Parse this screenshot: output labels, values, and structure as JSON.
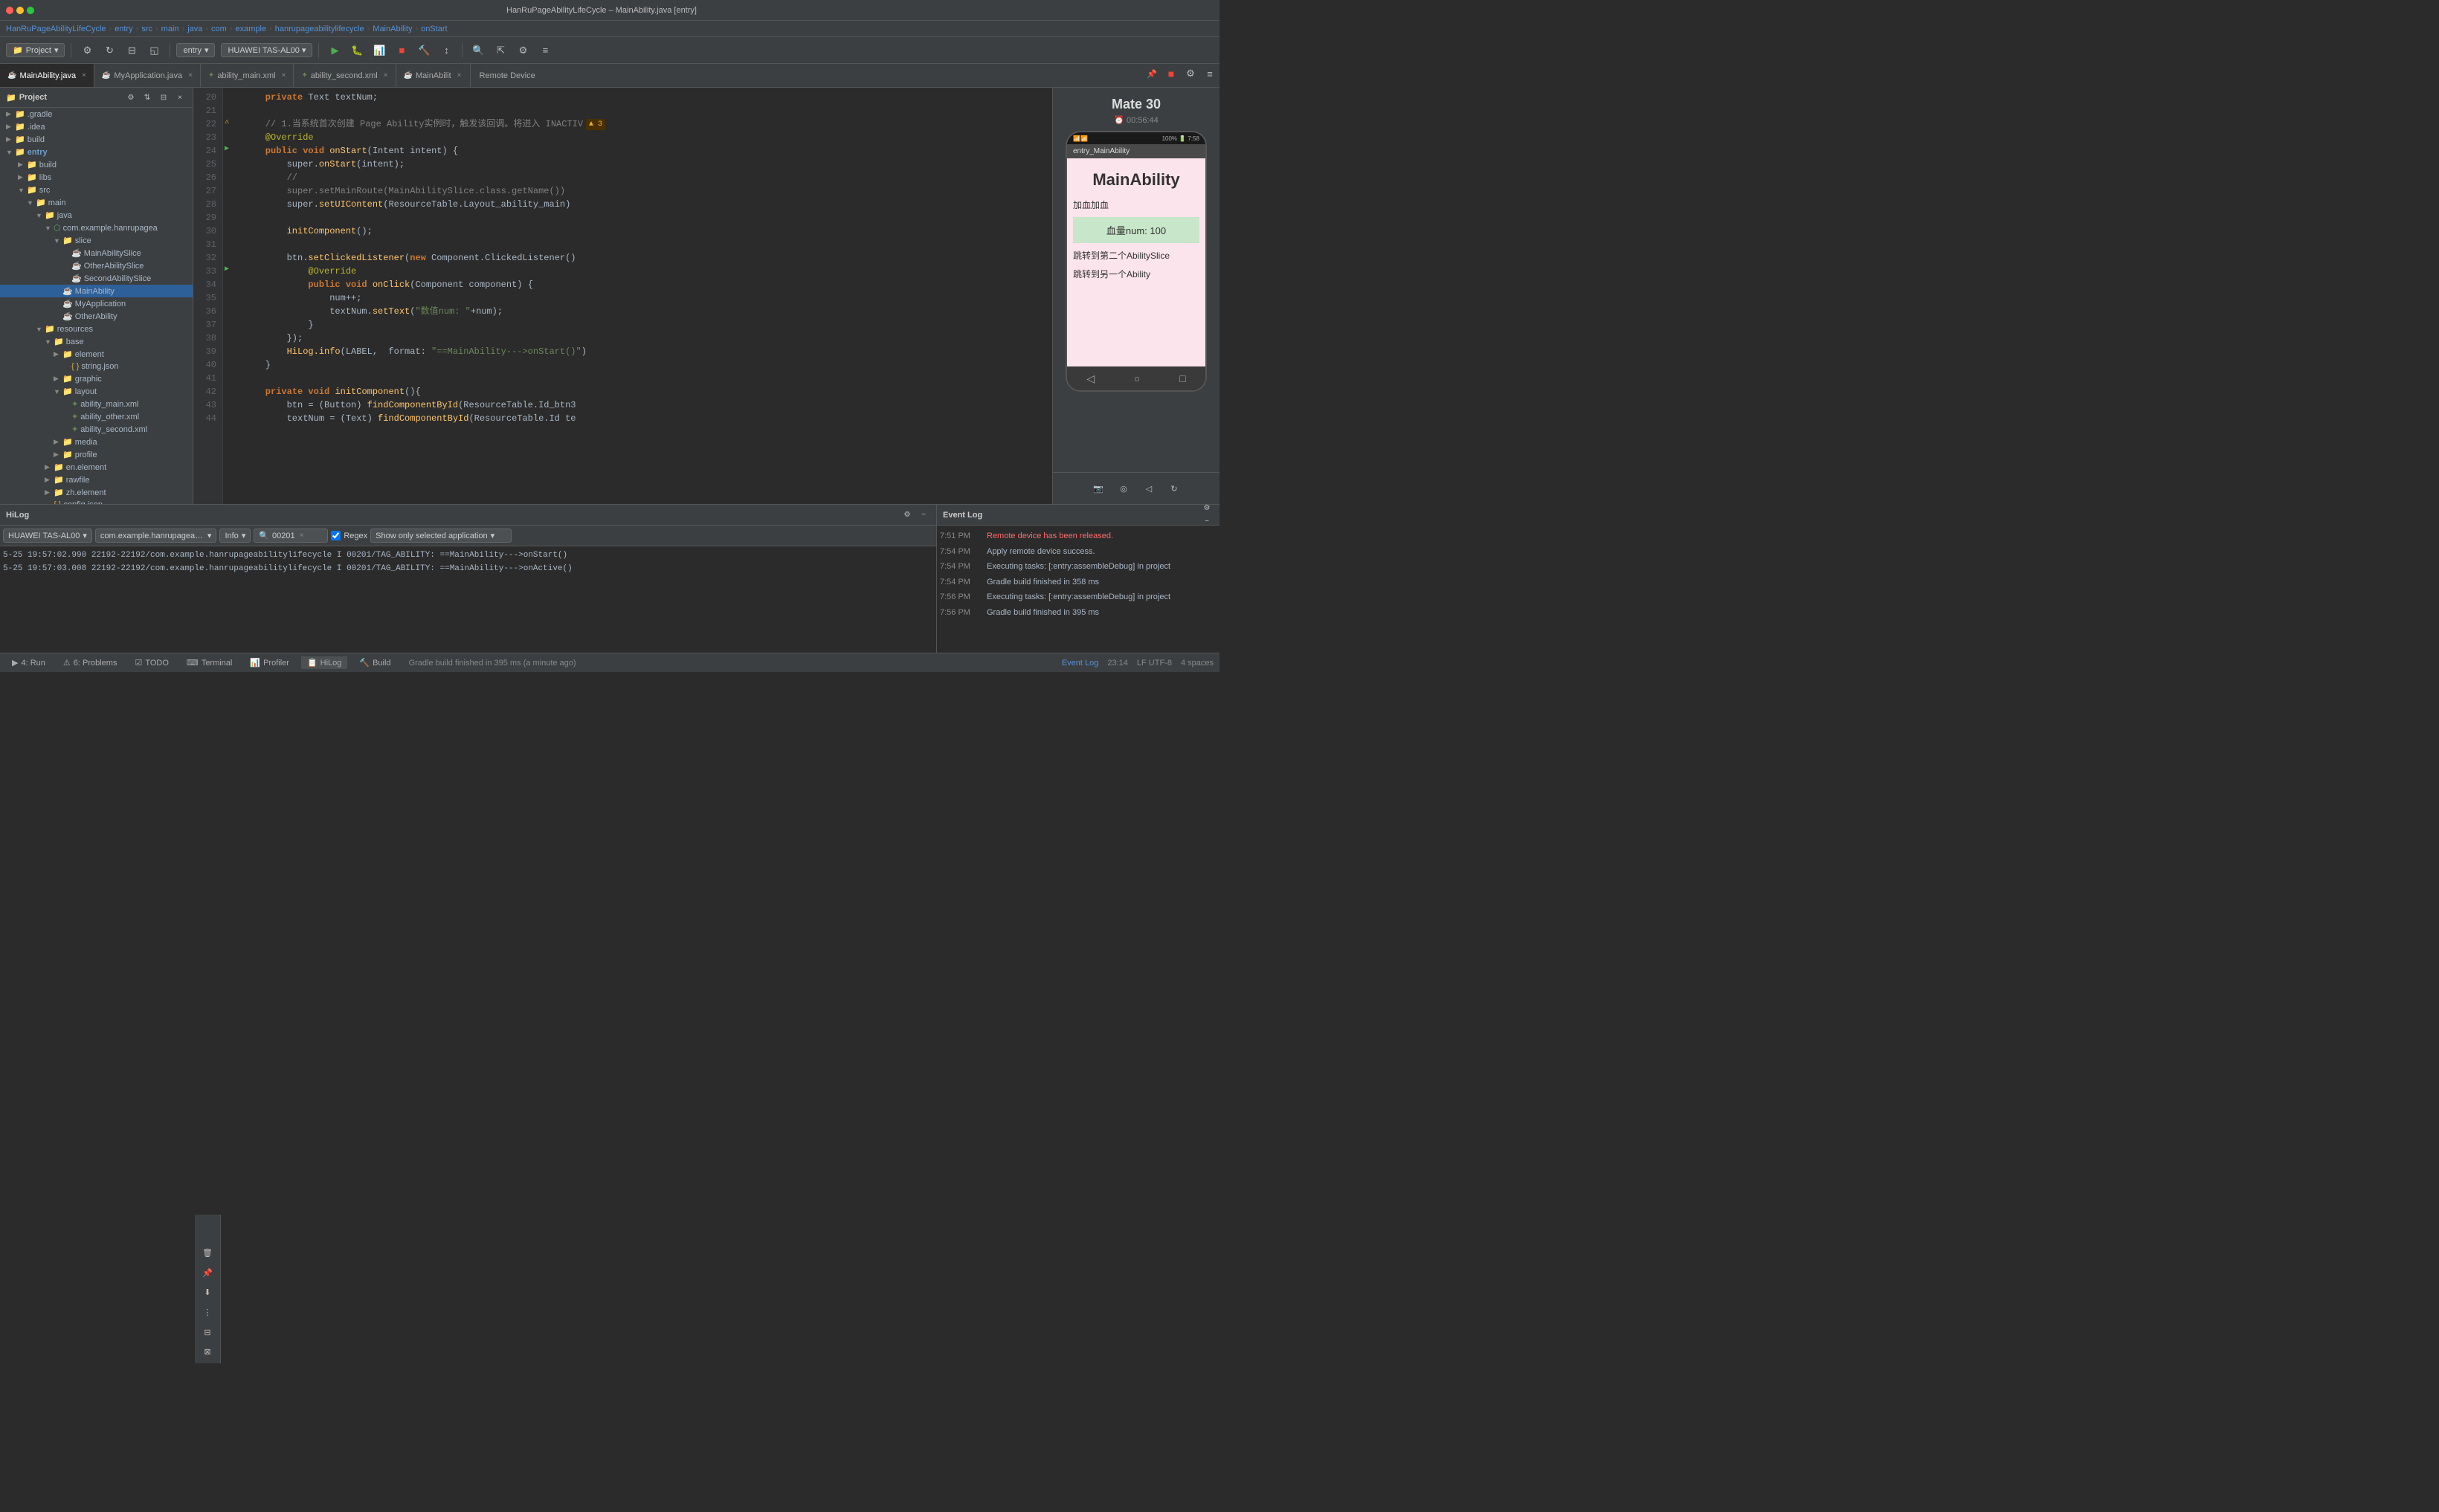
{
  "titlebar": {
    "title": "HanRuPageAbilityLifeCycle – MainAbility.java [entry]",
    "traffic_lights": [
      "red",
      "yellow",
      "green"
    ]
  },
  "breadcrumb": {
    "items": [
      "HanRuPageAbilityLifeCycle",
      "entry",
      "src",
      "main",
      "java",
      "com",
      "example",
      "hanrupageabilitylifecycle",
      "MainAbility",
      "onStart"
    ]
  },
  "toolbar": {
    "project_label": "Project",
    "entry_label": "entry",
    "device_label": "HUAWEI TAS-AL00"
  },
  "tabs": [
    {
      "label": "MainAbility.java",
      "type": "java",
      "active": true
    },
    {
      "label": "MyApplication.java",
      "type": "java",
      "active": false
    },
    {
      "label": "ability_main.xml",
      "type": "xml",
      "active": false
    },
    {
      "label": "ability_second.xml",
      "type": "xml",
      "active": false
    },
    {
      "label": "MainAbilit",
      "type": "java",
      "active": false
    },
    {
      "label": "Remote Device",
      "type": "remote",
      "active": false
    }
  ],
  "sidebar": {
    "project_label": "Project",
    "tree": [
      {
        "label": ".gradle",
        "level": 1,
        "type": "folder",
        "expanded": false
      },
      {
        "label": ".idea",
        "level": 1,
        "type": "folder",
        "expanded": false
      },
      {
        "label": "build",
        "level": 1,
        "type": "folder",
        "expanded": false
      },
      {
        "label": "entry",
        "level": 1,
        "type": "folder",
        "expanded": true,
        "active": true
      },
      {
        "label": "build",
        "level": 2,
        "type": "folder",
        "expanded": false
      },
      {
        "label": "libs",
        "level": 2,
        "type": "folder",
        "expanded": false
      },
      {
        "label": "src",
        "level": 2,
        "type": "folder",
        "expanded": true
      },
      {
        "label": "main",
        "level": 3,
        "type": "folder",
        "expanded": true
      },
      {
        "label": "java",
        "level": 4,
        "type": "folder",
        "expanded": true
      },
      {
        "label": "com.example.hanrupagea",
        "level": 5,
        "type": "package",
        "expanded": true
      },
      {
        "label": "slice",
        "level": 6,
        "type": "folder",
        "expanded": true
      },
      {
        "label": "MainAbilitySlice",
        "level": 7,
        "type": "java"
      },
      {
        "label": "OtherAbilitySlice",
        "level": 7,
        "type": "java"
      },
      {
        "label": "SecondAbilitySlice",
        "level": 7,
        "type": "java"
      },
      {
        "label": "MainAbility",
        "level": 6,
        "type": "java",
        "selected": true
      },
      {
        "label": "MyApplication",
        "level": 6,
        "type": "java"
      },
      {
        "label": "OtherAbility",
        "level": 6,
        "type": "java"
      },
      {
        "label": "resources",
        "level": 4,
        "type": "folder",
        "expanded": true
      },
      {
        "label": "base",
        "level": 5,
        "type": "folder",
        "expanded": true
      },
      {
        "label": "element",
        "level": 6,
        "type": "folder",
        "expanded": false
      },
      {
        "label": "string.json",
        "level": 7,
        "type": "json"
      },
      {
        "label": "graphic",
        "level": 6,
        "type": "folder",
        "expanded": false
      },
      {
        "label": "layout",
        "level": 6,
        "type": "folder",
        "expanded": false
      },
      {
        "label": "ability_main.xml",
        "level": 7,
        "type": "xml"
      },
      {
        "label": "ability_other.xml",
        "level": 7,
        "type": "xml"
      },
      {
        "label": "ability_second.xml",
        "level": 7,
        "type": "xml"
      },
      {
        "label": "media",
        "level": 6,
        "type": "folder",
        "expanded": false
      },
      {
        "label": "profile",
        "level": 6,
        "type": "folder",
        "expanded": false
      },
      {
        "label": "en.element",
        "level": 5,
        "type": "folder",
        "expanded": false
      },
      {
        "label": "rawfile",
        "level": 5,
        "type": "folder",
        "expanded": false
      },
      {
        "label": "zh.element",
        "level": 5,
        "type": "folder",
        "expanded": false
      },
      {
        "label": "config.json",
        "level": 5,
        "type": "json"
      }
    ]
  },
  "code": {
    "lines": [
      {
        "num": 20,
        "content": "    private Text textNum;",
        "tokens": [
          {
            "t": "kw",
            "v": "private"
          },
          {
            "t": "",
            "v": " Text textNum;"
          }
        ]
      },
      {
        "num": 21,
        "content": ""
      },
      {
        "num": 22,
        "content": "    // 1.当系统首次创建 Page Ability实例时，触发该回调。将进入 INACTIV",
        "tokens": [
          {
            "t": "comment",
            "v": "    // 1.当系统首次创建 Page Ability实例时，触发该回调。将进入 INACTIV"
          }
        ]
      },
      {
        "num": 23,
        "content": "    @Override",
        "tokens": [
          {
            "t": "annotation",
            "v": "    @Override"
          }
        ]
      },
      {
        "num": 24,
        "content": "    public void onStart(Intent intent) {",
        "tokens": [
          {
            "t": "kw",
            "v": "    public"
          },
          {
            "t": "",
            "v": " "
          },
          {
            "t": "kw",
            "v": "void"
          },
          {
            "t": "",
            "v": " "
          },
          {
            "t": "func",
            "v": "onStart"
          },
          {
            "t": "",
            "v": "(Intent intent) {"
          }
        ]
      },
      {
        "num": 25,
        "content": "        super.onStart(intent);",
        "tokens": [
          {
            "t": "",
            "v": "        super."
          },
          {
            "t": "func",
            "v": "onStart"
          },
          {
            "t": "",
            "v": "(intent);"
          }
        ]
      },
      {
        "num": 26,
        "content": "        //",
        "tokens": [
          {
            "t": "comment",
            "v": "        //"
          }
        ]
      },
      {
        "num": 27,
        "content": "        super.setMainRoute(MainAbilitySlice.class.getName())",
        "tokens": [
          {
            "t": "comment",
            "v": "        super.setMainRoute(MainAbilitySlice.class.getName())"
          }
        ]
      },
      {
        "num": 28,
        "content": "        super.setUIContent(ResourceTable.Layout_ability_main)",
        "tokens": [
          {
            "t": "",
            "v": "        super."
          },
          {
            "t": "func",
            "v": "setUIContent"
          },
          {
            "t": "",
            "v": "(ResourceTable.Layout_ability_main)"
          }
        ]
      },
      {
        "num": 29,
        "content": ""
      },
      {
        "num": 30,
        "content": "        initComponent();",
        "tokens": [
          {
            "t": "",
            "v": "        "
          },
          {
            "t": "func",
            "v": "initComponent"
          },
          {
            "t": "",
            "v": "();"
          }
        ]
      },
      {
        "num": 31,
        "content": ""
      },
      {
        "num": 32,
        "content": "        btn.setClickedListener(new Component.ClickedListener()",
        "tokens": [
          {
            "t": "",
            "v": "        btn."
          },
          {
            "t": "func",
            "v": "setClickedListener"
          },
          {
            "t": "",
            "v": "(new Component.ClickedListener()"
          }
        ]
      },
      {
        "num": 33,
        "content": "            @Override",
        "tokens": [
          {
            "t": "annotation",
            "v": "            @Override"
          }
        ]
      },
      {
        "num": 34,
        "content": "            public void onClick(Component component) {",
        "tokens": [
          {
            "t": "kw",
            "v": "            public"
          },
          {
            "t": "",
            "v": " "
          },
          {
            "t": "kw",
            "v": "void"
          },
          {
            "t": "",
            "v": " "
          },
          {
            "t": "func",
            "v": "onClick"
          },
          {
            "t": "",
            "v": "(Component component) {"
          }
        ]
      },
      {
        "num": 35,
        "content": "                num++;",
        "tokens": [
          {
            "t": "",
            "v": "                num++;"
          }
        ]
      },
      {
        "num": 36,
        "content": "                textNum.setText(\"数值num: \"+num);",
        "tokens": [
          {
            "t": "",
            "v": "                textNum."
          },
          {
            "t": "func",
            "v": "setText"
          },
          {
            "t": "",
            "v": "("
          },
          {
            "t": "str",
            "v": "\"数值num: \""
          },
          {
            "t": "",
            "v": "+num);"
          }
        ]
      },
      {
        "num": 37,
        "content": "            }",
        "tokens": [
          {
            "t": "",
            "v": "            }"
          }
        ]
      },
      {
        "num": 38,
        "content": "        });",
        "tokens": [
          {
            "t": "",
            "v": "        });"
          }
        ]
      },
      {
        "num": 39,
        "content": "        HiLog.info(LABEL,  format: \"==MainAbility--->onStart()\")",
        "tokens": [
          {
            "t": "",
            "v": "        "
          },
          {
            "t": "func",
            "v": "HiLog.info"
          },
          {
            "t": "",
            "v": "(LABEL,  format: "
          },
          {
            "t": "str",
            "v": "\"==MainAbility--->onStart()\""
          },
          {
            "t": "",
            "v": ")"
          }
        ]
      },
      {
        "num": 40,
        "content": "    }"
      },
      {
        "num": 41,
        "content": ""
      },
      {
        "num": 42,
        "content": "    private void initComponent(){",
        "tokens": [
          {
            "t": "kw",
            "v": "    private"
          },
          {
            "t": "",
            "v": " "
          },
          {
            "t": "kw",
            "v": "void"
          },
          {
            "t": "",
            "v": " "
          },
          {
            "t": "func",
            "v": "initComponent"
          },
          {
            "t": "",
            "v": "(){"
          }
        ]
      },
      {
        "num": 43,
        "content": "        btn = (Button) findComponentById(ResourceTable.Id_btn3",
        "tokens": [
          {
            "t": "",
            "v": "        btn = (Button) "
          },
          {
            "t": "func",
            "v": "findComponentById"
          },
          {
            "t": "",
            "v": "(ResourceTable.Id_btn3"
          }
        ]
      },
      {
        "num": 44,
        "content": "        textNum = (Text) findComponentById(ResourceTable.Id te",
        "tokens": [
          {
            "t": "",
            "v": "        textNum = (Text) "
          },
          {
            "t": "func",
            "v": "findComponentById"
          },
          {
            "t": "",
            "v": "(ResourceTable.Id te"
          }
        ]
      }
    ]
  },
  "remote_device": {
    "name": "Mate 30",
    "time": "00:56:44",
    "app_bar": "entry_MainAbility",
    "main_title": "MainAbility",
    "text1": "加血加血",
    "blood_label": "血量num:  100",
    "link1": "跳转到第二个AbilitySlice",
    "link2": "跳转到另一个Ability"
  },
  "hilog": {
    "panel_label": "HiLog",
    "device_select": "HUAWEI TAS-AL00",
    "package_select": "com.example.hanrupageabilitylifecycli",
    "level_select": "Info",
    "search_value": "00201",
    "regex_label": "Regex",
    "show_selected_label": "Show only selected application",
    "rows": [
      {
        "content": "5-25 19:57:02.990  22192-22192/com.example.hanrupageabilitylifecycle I 00201/TAG_ABILITY:  ==MainAbility--->onStart()"
      },
      {
        "content": "5-25 19:57:03.008  22192-22192/com.example.hanrupageabilitylifecycle I 00201/TAG_ABILITY:  ==MainAbility--->onActive()"
      }
    ]
  },
  "event_log": {
    "panel_label": "Event Log",
    "events": [
      {
        "time": "7:51 PM",
        "msg": "Remote device has been released.",
        "type": "red"
      },
      {
        "time": "7:54 PM",
        "msg": "Apply remote device success.",
        "type": "normal"
      },
      {
        "time": "7:54 PM",
        "msg": "Executing tasks: [:entry:assembleDebug] in project",
        "type": "normal"
      },
      {
        "time": "7:54 PM",
        "msg": "Gradle build finished in 358 ms",
        "type": "normal"
      },
      {
        "time": "7:56 PM",
        "msg": "Executing tasks: [:entry:assembleDebug] in project",
        "type": "normal"
      },
      {
        "time": "7:56 PM",
        "msg": "Gradle build finished in 395 ms",
        "type": "normal"
      }
    ]
  },
  "statusbar": {
    "tabs": [
      {
        "label": "4: Run",
        "icon": "▶"
      },
      {
        "label": "6: Problems",
        "icon": "⚠"
      },
      {
        "label": "TODO",
        "icon": "☑"
      },
      {
        "label": "Terminal",
        "icon": "⌨"
      },
      {
        "label": "Profiler",
        "icon": "📊"
      },
      {
        "label": "HiLog",
        "icon": "📋"
      },
      {
        "label": "Build",
        "icon": "🔨"
      }
    ],
    "gradle_msg": "Gradle build finished in 395 ms (a minute ago)",
    "event_log_label": "Event Log",
    "line_col": "23:14",
    "encoding": "LF  UTF-8",
    "indent": "4 spaces"
  }
}
